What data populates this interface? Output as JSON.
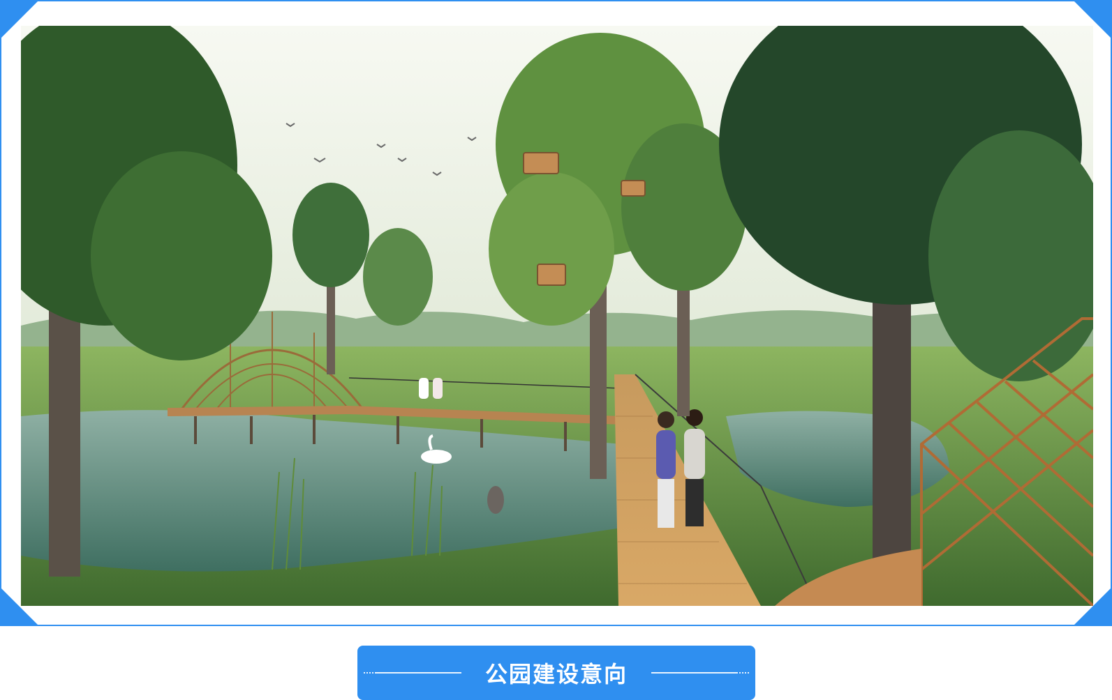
{
  "caption": {
    "title": "公园建设意向"
  },
  "colors": {
    "accent": "#2f8ff0",
    "caption_text": "#ffffff"
  },
  "image": {
    "subject": "park-wetland-boardwalk-rendering"
  }
}
